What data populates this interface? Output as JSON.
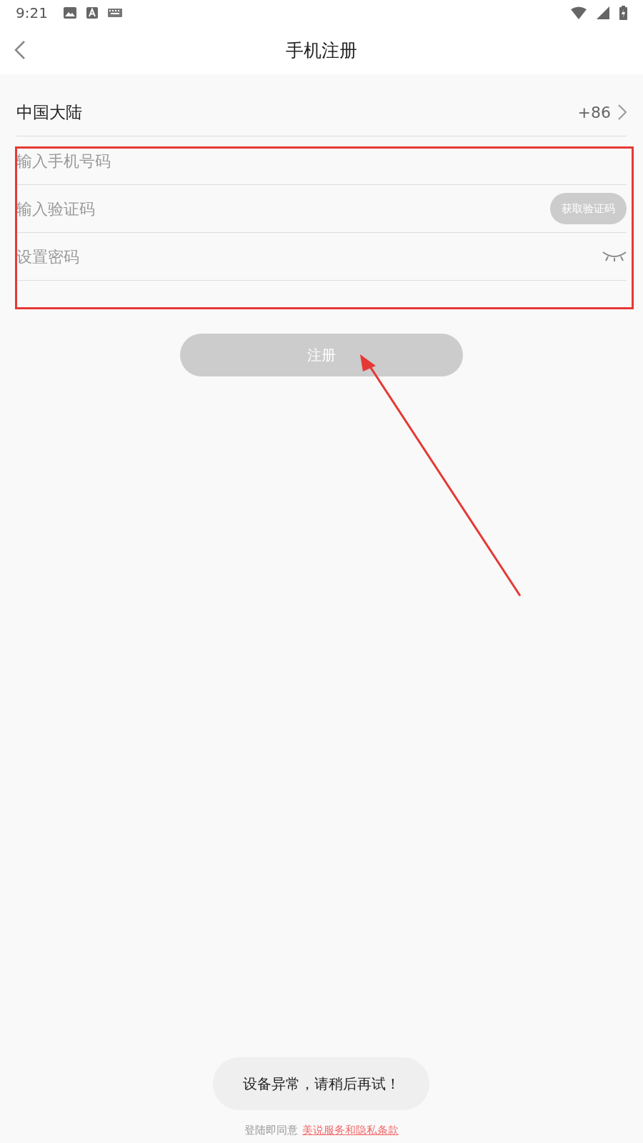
{
  "status_bar": {
    "time": "9:21"
  },
  "header": {
    "title": "手机注册"
  },
  "region": {
    "name": "中国大陆",
    "code": "+86"
  },
  "fields": [
    {
      "kind": "phone",
      "placeholder": "输入手机号码"
    },
    {
      "kind": "code",
      "placeholder": "输入验证码",
      "button": "获取验证码"
    },
    {
      "kind": "password",
      "placeholder": "设置密码"
    }
  ],
  "register_button": {
    "label": "注册",
    "disabled": true
  },
  "agreement": {
    "prefix": "登陆即同意",
    "link": "美说服务和隐私条款"
  },
  "toast": {
    "message": "设备异常，请稍后再试！"
  }
}
